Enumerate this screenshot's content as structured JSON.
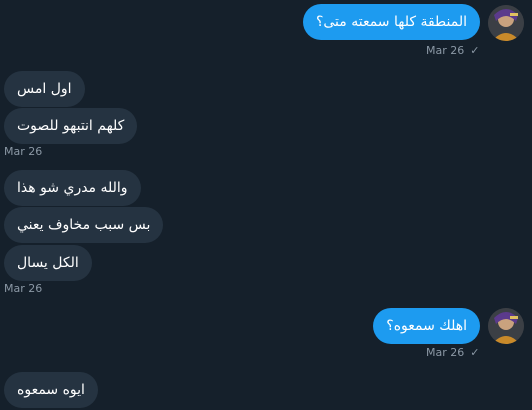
{
  "messages": [
    {
      "dir": "out",
      "text": "المنطقة كلها سمعته متى؟"
    },
    {
      "dir": "in",
      "text": "اول امس"
    },
    {
      "dir": "in",
      "text": "كلهم انتبهو للصوت"
    },
    {
      "dir": "in",
      "text": "والله مدري شو هذا"
    },
    {
      "dir": "in",
      "text": "بس سبب مخاوف يعني"
    },
    {
      "dir": "in",
      "text": "الكل يسال"
    },
    {
      "dir": "out",
      "text": "اهلك سمعوه؟"
    },
    {
      "dir": "in",
      "text": "ايوه سمعوه"
    }
  ],
  "timestamps": {
    "out_1": "Mar 26",
    "in_1": "Mar 26",
    "in_2": "Mar 26",
    "out_2": "Mar 26"
  },
  "icons": {
    "read_receipt": "check-icon",
    "avatar": "user-avatar"
  },
  "colors": {
    "background": "#15202b",
    "incoming_bubble": "#253341",
    "outgoing_bubble": "#1d9bf0",
    "timestamp": "#8b98a5"
  }
}
